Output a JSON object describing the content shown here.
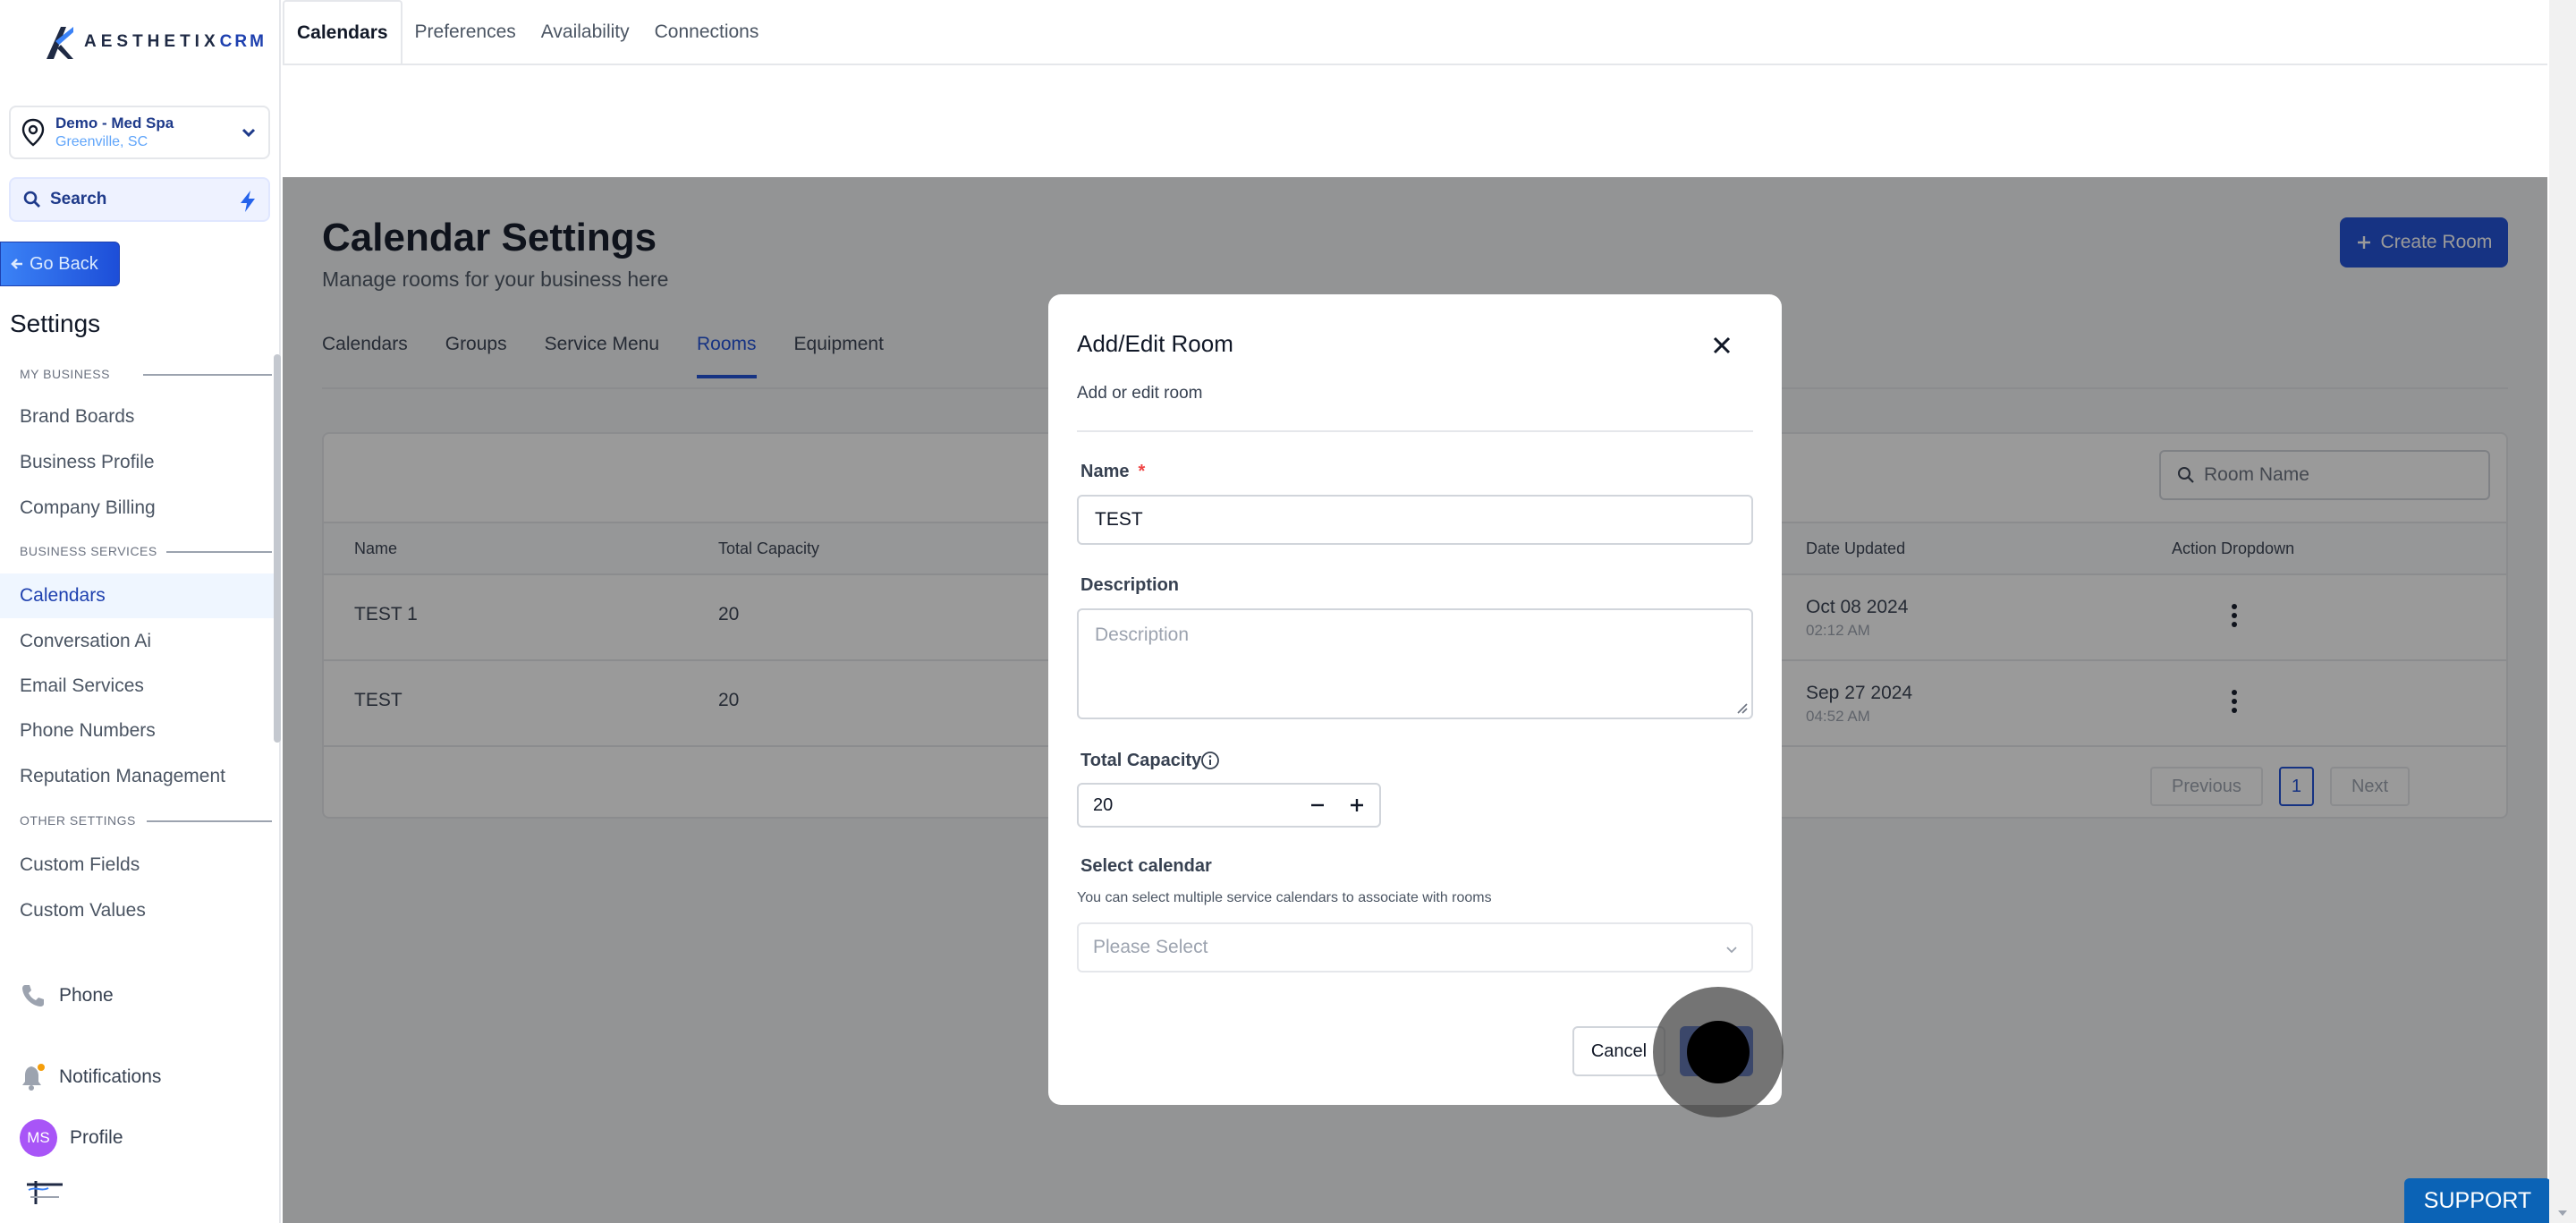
{
  "brand": {
    "logo_text": "AESTHETIX",
    "logo_suffix": "CRM"
  },
  "sidebar": {
    "location": {
      "name": "Demo - Med Spa",
      "city": "Greenville, SC"
    },
    "search_label": "Search",
    "go_back_label": "Go Back",
    "settings_title": "Settings",
    "sections": [
      {
        "label": "MY BUSINESS",
        "items": [
          "Brand Boards",
          "Business Profile",
          "Company Billing"
        ]
      },
      {
        "label": "BUSINESS SERVICES",
        "items": [
          "Calendars",
          "Conversation Ai",
          "Email Services",
          "Phone Numbers",
          "Reputation Management"
        ]
      },
      {
        "label": "OTHER SETTINGS",
        "items": [
          "Custom Fields",
          "Custom Values"
        ]
      }
    ],
    "active_item": "Calendars",
    "bottom": {
      "phone": "Phone",
      "notifications": "Notifications",
      "profile": "Profile",
      "avatar_initials": "MS"
    }
  },
  "topnav": {
    "tabs": [
      "Calendars",
      "Preferences",
      "Availability",
      "Connections"
    ],
    "active": "Calendars"
  },
  "main": {
    "title": "Calendar Settings",
    "subtitle": "Manage rooms for your business here",
    "create_button": "Create Room",
    "subtabs": [
      "Calendars",
      "Groups",
      "Service Menu",
      "Rooms",
      "Equipment"
    ],
    "active_subtab": "Rooms",
    "search_placeholder": "Room Name",
    "table": {
      "columns": [
        "Name",
        "Total Capacity",
        "Date Updated",
        "Action Dropdown"
      ],
      "rows": [
        {
          "name": "TEST 1",
          "capacity": "20",
          "date": "Oct 08 2024",
          "time": "02:12 AM"
        },
        {
          "name": "TEST",
          "capacity": "20",
          "date": "Sep 27 2024",
          "time": "04:52 AM"
        }
      ]
    },
    "pagination": {
      "previous": "Previous",
      "current": "1",
      "next": "Next"
    }
  },
  "modal": {
    "title": "Add/Edit Room",
    "subtitle": "Add or edit room",
    "name_label": "Name",
    "required_mark": "*",
    "name_value": "TEST",
    "description_label": "Description",
    "description_placeholder": "Description",
    "capacity_label": "Total Capacity",
    "capacity_value": "20",
    "calendar_label": "Select calendar",
    "calendar_help": "You can select multiple service calendars to associate with rooms",
    "calendar_placeholder": "Please Select",
    "cancel_label": "Cancel"
  },
  "support_label": "SUPPORT",
  "colors": {
    "accent": "#1d4ed8",
    "overlay": "rgba(15,15,15,0.42)",
    "support": "#0b63b6"
  }
}
